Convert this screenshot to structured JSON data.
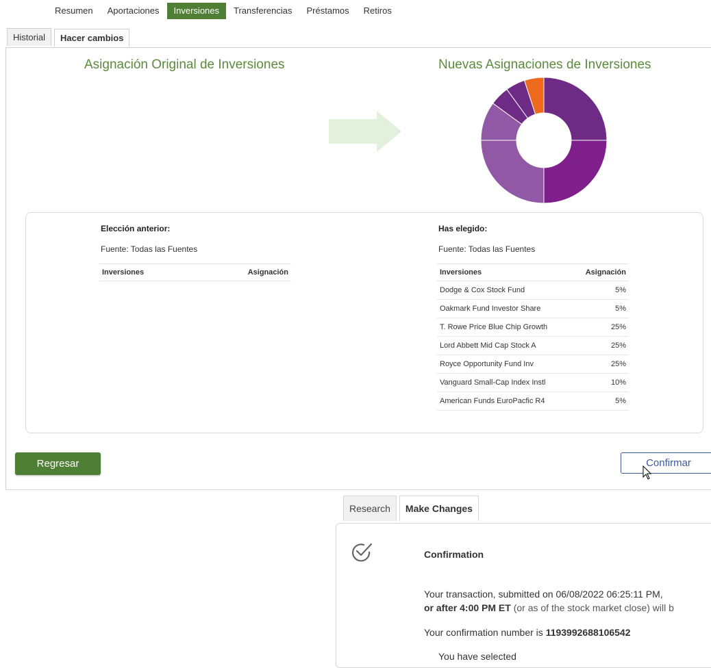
{
  "nav": {
    "items": [
      "Resumen",
      "Aportaciones",
      "Inversiones",
      "Transferencias",
      "Préstamos",
      "Retiros"
    ],
    "active": "Inversiones"
  },
  "subtabs": [
    "Historial",
    "Hacer cambios"
  ],
  "headings": {
    "original": "Asignación Original de Inversiones",
    "new": "Nuevas Asignaciones de Inversiones"
  },
  "previous": {
    "title": "Elección anterior:",
    "source": "Fuente: Todas las Fuentes",
    "col_investment": "Inversiones",
    "col_allocation": "Asignación"
  },
  "chosen": {
    "title": "Has elegido:",
    "source": "Fuente: Todas las Fuentes",
    "col_investment": "Inversiones",
    "col_allocation": "Asignación",
    "rows": [
      {
        "fund": "Dodge & Cox Stock Fund",
        "pct": "5%"
      },
      {
        "fund": "Oakmark Fund Investor Share",
        "pct": "5%"
      },
      {
        "fund": "T. Rowe Price Blue Chip Growth",
        "pct": "25%"
      },
      {
        "fund": "Lord Abbett Mid Cap Stock A",
        "pct": "25%"
      },
      {
        "fund": "Royce Opportunity Fund Inv",
        "pct": "25%"
      },
      {
        "fund": "Vanguard Small-Cap Index Instl",
        "pct": "10%"
      },
      {
        "fund": "American Funds EuroPacfic R4",
        "pct": "5%"
      }
    ]
  },
  "donut": {
    "slices": [
      {
        "value": 25,
        "color": "#6d2b86"
      },
      {
        "value": 25,
        "color": "#7f1f8c"
      },
      {
        "value": 25,
        "color": "#9158a6"
      },
      {
        "value": 10,
        "color": "#9158a6"
      },
      {
        "value": 5,
        "color": "#6d2b86"
      },
      {
        "value": 5,
        "color": "#6d2b86"
      },
      {
        "value": 5,
        "color": "#ee6a1f"
      }
    ]
  },
  "buttons": {
    "back": "Regresar",
    "confirm": "Confirmar"
  },
  "research": {
    "tabs": [
      "Research",
      "Make Changes"
    ],
    "title": "Confirmation",
    "line1": "Your transaction, submitted on 06/08/2022 06:25:11 PM,",
    "line2_bold": "or after 4:00 PM ET",
    "line2_rest": " (or as of the stock market close) will b",
    "line3_prefix": "Your confirmation number is ",
    "confirmation_number": "1193992688106542",
    "line4": "You have selected"
  },
  "colors": {
    "accent_green": "#4e7f34",
    "heading_green": "#5b8a3c",
    "confirm_blue": "#3c5a9e"
  }
}
